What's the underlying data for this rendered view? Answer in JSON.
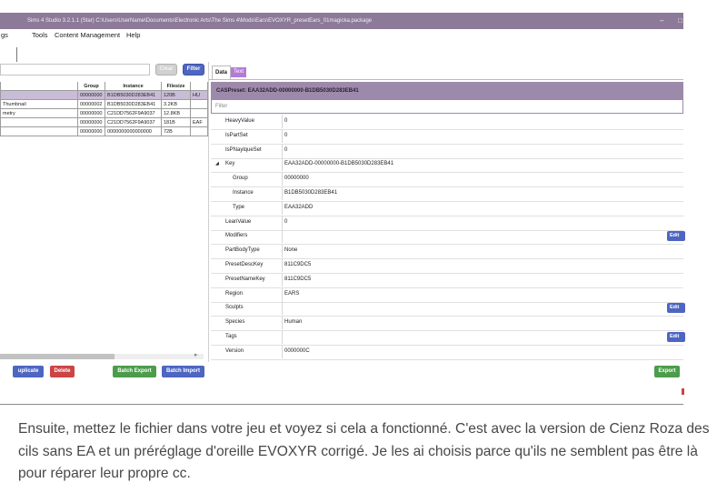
{
  "window": {
    "title": "Sims 4 Studio 3.2.1.1 (Star)  C:\\Users\\UserName\\Documents\\Electronic Arts\\The Sims 4\\Mods\\Ears\\EVOXYR_presetEars_01magicka.package",
    "controls": [
      "–",
      "□"
    ]
  },
  "menu": [
    {
      "label": "gs"
    },
    {
      "label": "Tools"
    },
    {
      "label": "Content Management"
    },
    {
      "label": "Help"
    }
  ],
  "left_pane": {
    "search": {
      "value": "",
      "placeholder": ""
    },
    "clear_label": "Clear",
    "filter_label": "Filter",
    "columns": [
      "",
      "Group",
      "Instance",
      "Filesize",
      ""
    ],
    "rows": [
      {
        "name": "",
        "group": "00000000",
        "instance": "B1DB5030D283EB41",
        "size": "120B",
        "type": "HU"
      },
      {
        "name": "Thumbnail",
        "group": "00000002",
        "instance": "B1DB5030D283EB41",
        "size": "3.2KB",
        "type": ""
      },
      {
        "name": "metry",
        "group": "00000000",
        "instance": "C21DD7562F9A9037",
        "size": "12.8KB",
        "type": ""
      },
      {
        "name": "",
        "group": "00000000",
        "instance": "C21DD7562F9A9037",
        "size": "181B",
        "type": "EAF"
      },
      {
        "name": "",
        "group": "00000000",
        "instance": "0000000000000000",
        "size": "72B",
        "type": ""
      }
    ],
    "scroll_arrow": "▸"
  },
  "buttons": {
    "duplicate": "uplicate",
    "delete": "Delete",
    "batch_export": "Batch Export",
    "batch_import": "Batch Import",
    "export": "Export"
  },
  "right_pane": {
    "tabs": [
      {
        "label": "Data"
      },
      {
        "label": "Text"
      }
    ],
    "header": "CASPreset: EAA32ADD-00000000-B1DB5030D283EB41",
    "filter_placeholder": "Filter",
    "edit_label": "Edit",
    "properties": [
      {
        "name": "HeavyValue",
        "value": "0"
      },
      {
        "name": "IsPartSet",
        "value": "0"
      },
      {
        "name": "IsPNaylqueSet",
        "value": "0"
      },
      {
        "name": "Key",
        "value": "EAA32ADD-00000000-B1DB5030D283EB41",
        "expand": "◢"
      },
      {
        "name": "Group",
        "value": "00000000",
        "child": true
      },
      {
        "name": "Instance",
        "value": "B1DB5030D283EB41",
        "child": true
      },
      {
        "name": "Type",
        "value": "EAA32ADD",
        "child": true
      },
      {
        "name": "LeanValue",
        "value": "0"
      },
      {
        "name": "Modifiers",
        "value": "",
        "edit": true
      },
      {
        "name": "PartBodyType",
        "value": "None"
      },
      {
        "name": "PresetDescKey",
        "value": "811C9DC5"
      },
      {
        "name": "PresetNameKey",
        "value": "811C9DC5"
      },
      {
        "name": "Region",
        "value": "EARS"
      },
      {
        "name": "Sculpts",
        "value": "",
        "edit": true
      },
      {
        "name": "Species",
        "value": "Human"
      },
      {
        "name": "Tags",
        "value": "",
        "edit": true
      },
      {
        "name": "Version",
        "value": "0000000C"
      }
    ]
  },
  "caption": "Ensuite, mettez le fichier dans votre jeu et voyez si cela a fonctionné. C'est avec la version de Cienz Roza des cils sans EA et un préréglage d'oreille EVOXYR corrigé. Je les ai choisis parce qu'ils ne semblent pas être là pour réparer leur propre cc."
}
